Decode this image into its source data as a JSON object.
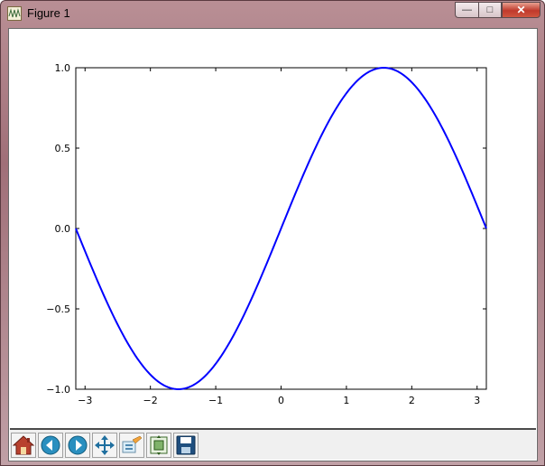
{
  "window": {
    "title": "Figure 1",
    "minimize_glyph": "—",
    "maximize_glyph": "□",
    "close_glyph": "✕"
  },
  "toolbar": {
    "buttons": [
      {
        "name": "home",
        "icon": "home-icon"
      },
      {
        "name": "back",
        "icon": "back-arrow-icon"
      },
      {
        "name": "forward",
        "icon": "forward-arrow-icon"
      },
      {
        "name": "pan",
        "icon": "move-icon"
      },
      {
        "name": "zoom",
        "icon": "zoom-rect-icon"
      },
      {
        "name": "subplots",
        "icon": "subplots-icon"
      },
      {
        "name": "save",
        "icon": "save-icon"
      }
    ]
  },
  "chart_data": {
    "type": "line",
    "function": "sin(x)",
    "xlim": [
      -3.14159,
      3.14159
    ],
    "ylim": [
      -1.0,
      1.0
    ],
    "x_ticks": [
      "−3",
      "−2",
      "−1",
      "0",
      "1",
      "2",
      "3"
    ],
    "y_ticks": [
      "−1.0",
      "−0.5",
      "0.0",
      "0.5",
      "1.0"
    ],
    "series": [
      {
        "color": "#0000ff",
        "x": [
          -3.14159,
          -2.8,
          -2.4,
          -2.0,
          -1.5708,
          -1.2,
          -0.8,
          -0.4,
          0.0,
          0.4,
          0.8,
          1.2,
          1.5708,
          2.0,
          2.4,
          2.8,
          3.14159
        ],
        "y": [
          0.0,
          -0.335,
          -0.675,
          -0.909,
          -1.0,
          -0.932,
          -0.717,
          -0.389,
          0.0,
          0.389,
          0.717,
          0.932,
          1.0,
          0.909,
          0.675,
          0.335,
          0.0
        ]
      }
    ],
    "grid": false
  }
}
